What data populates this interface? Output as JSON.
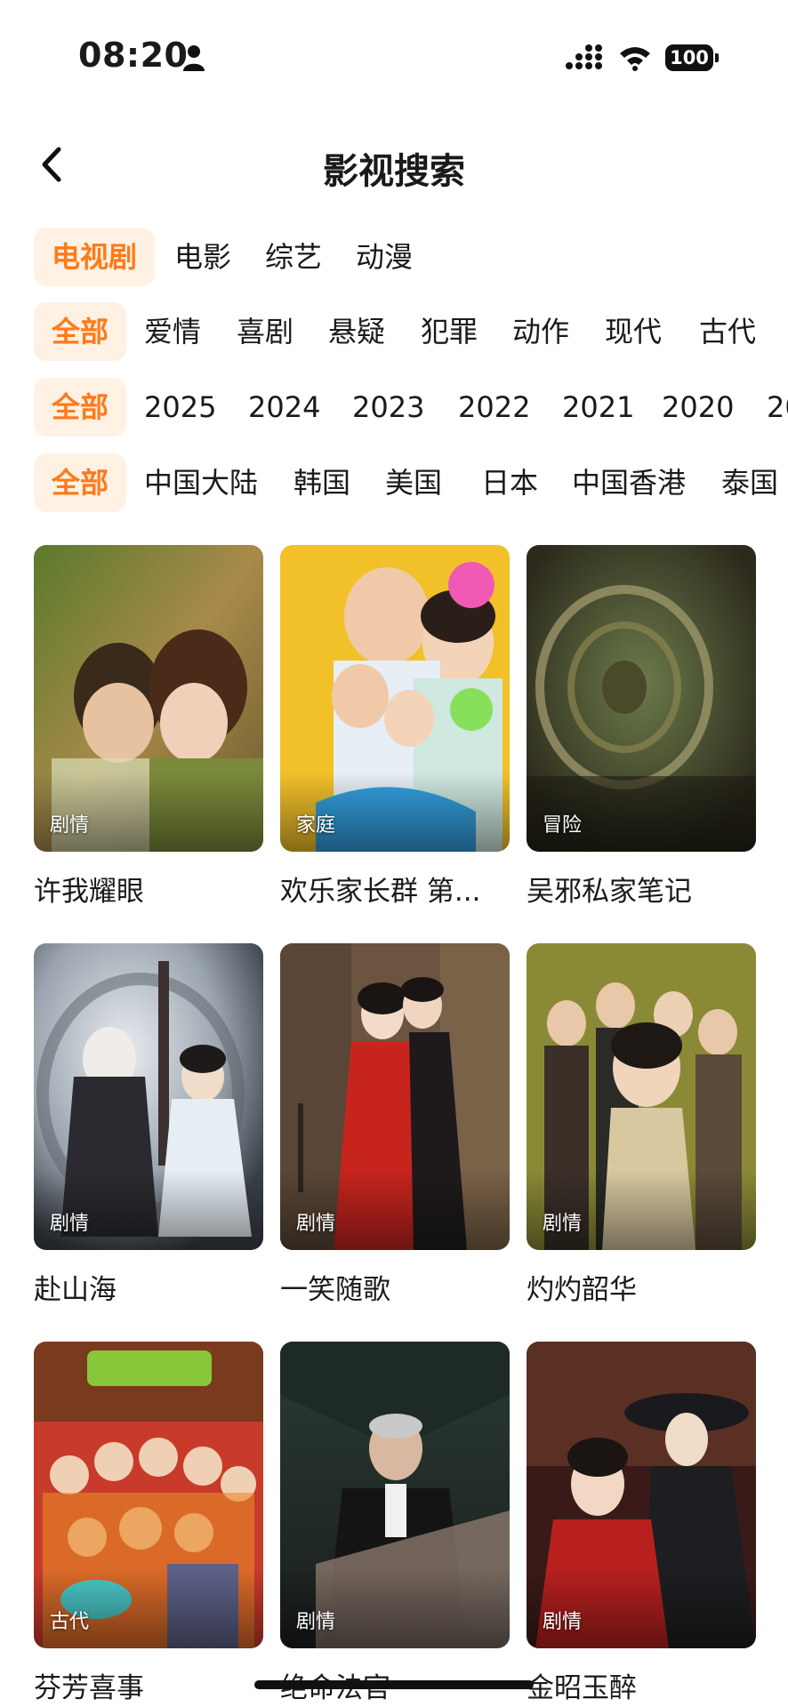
{
  "status_bar": {
    "time": "08:20",
    "battery": "100"
  },
  "header": {
    "title": "影视搜索"
  },
  "filters": {
    "category": [
      "电视剧",
      "电影",
      "综艺",
      "动漫"
    ],
    "genre": [
      "全部",
      "爱情",
      "喜剧",
      "悬疑",
      "犯罪",
      "动作",
      "现代",
      "古代"
    ],
    "year": [
      "全部",
      "2025",
      "2024",
      "2023",
      "2022",
      "2021",
      "2020",
      "20"
    ],
    "region": [
      "全部",
      "中国大陆",
      "韩国",
      "美国",
      "日本",
      "中国香港",
      "泰国"
    ]
  },
  "results": [
    {
      "title": "许我耀眼",
      "tag": "剧情"
    },
    {
      "title": "欢乐家长群 第...",
      "tag": "家庭"
    },
    {
      "title": "吴邪私家笔记",
      "tag": "冒险"
    },
    {
      "title": "赴山海",
      "tag": "剧情"
    },
    {
      "title": "一笑随歌",
      "tag": "剧情"
    },
    {
      "title": "灼灼韶华",
      "tag": "剧情"
    },
    {
      "title": "芬芳喜事",
      "tag": "古代"
    },
    {
      "title": "绝命法官",
      "tag": "剧情"
    },
    {
      "title": "金昭玉醉",
      "tag": "剧情"
    }
  ],
  "colors": {
    "accent": "#ff7a1a",
    "chip_bg": "#fff1e3"
  }
}
